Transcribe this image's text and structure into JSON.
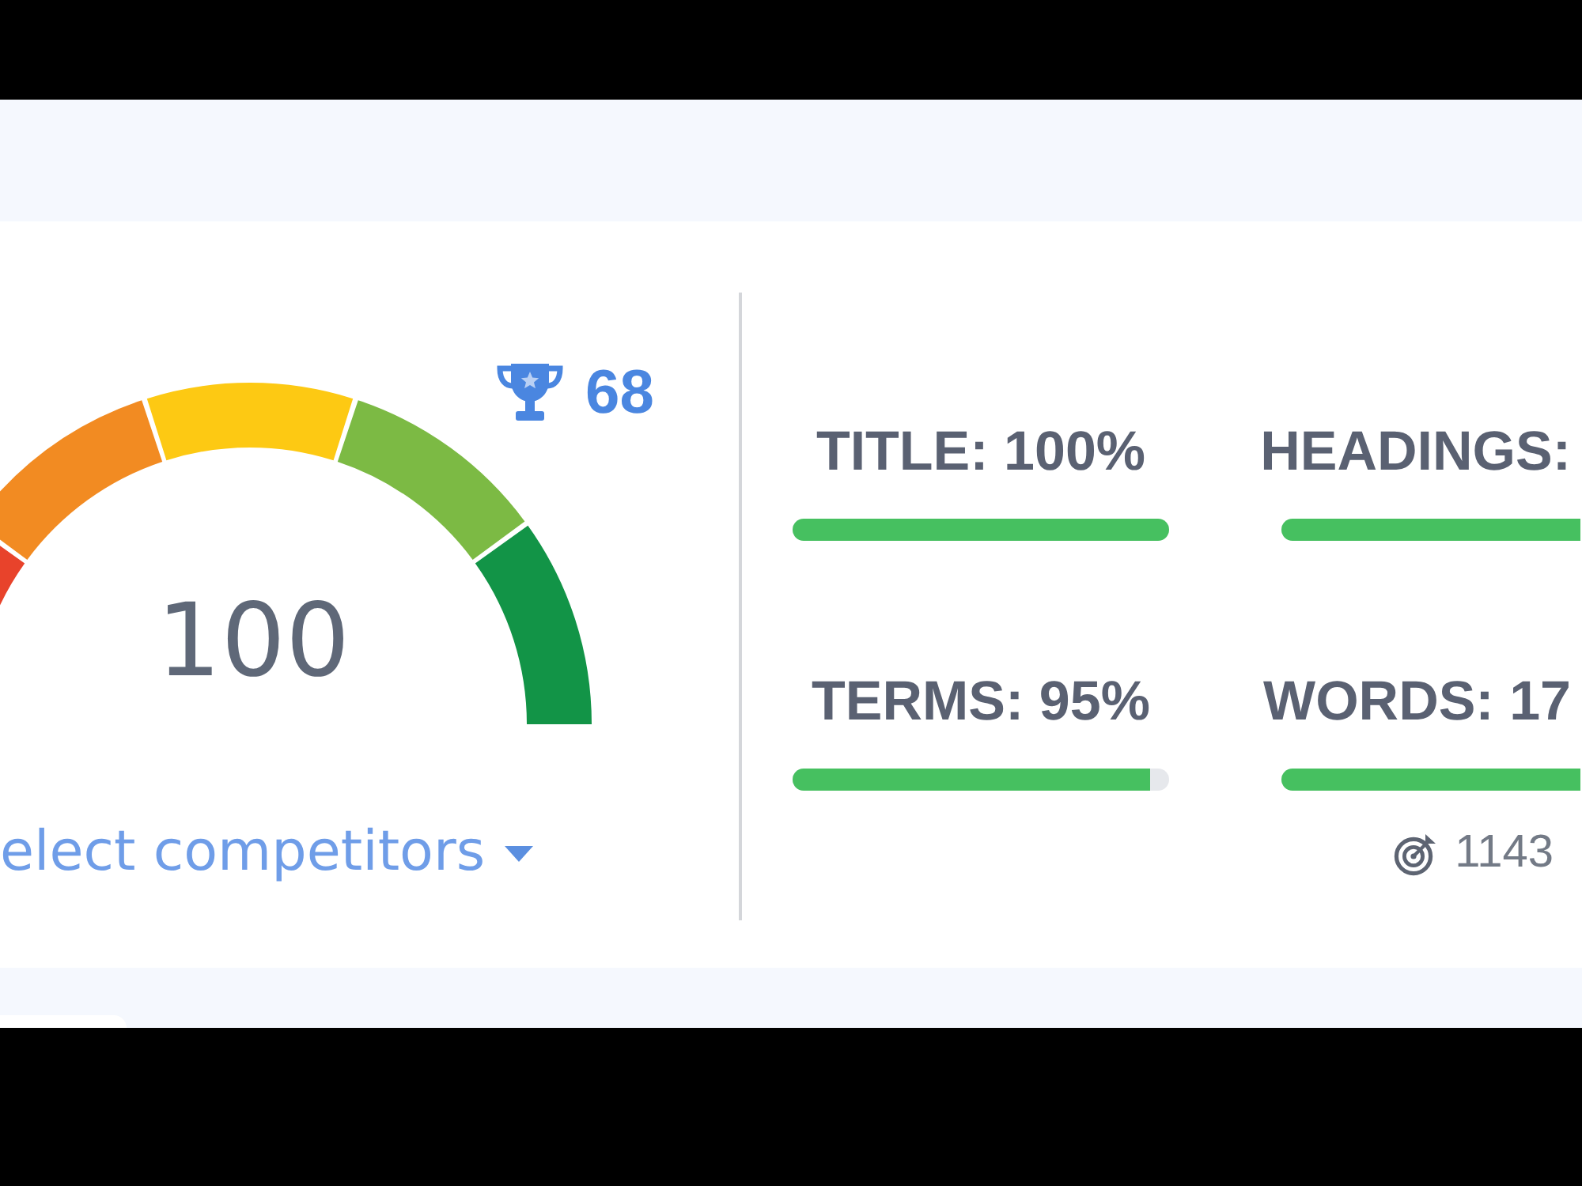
{
  "score_panel": {
    "competitor_score": "68",
    "score": "100",
    "competitors_dropdown": "elect competitors"
  },
  "metrics": [
    {
      "label": "TITLE: 100%",
      "level": 1
    },
    {
      "label": "HEADINGS:",
      "level": 1
    },
    {
      "label": "TERMS: 95%",
      "level": 0.95
    },
    {
      "label": "WORDS: 17",
      "level": 1,
      "target": "1143"
    }
  ]
}
